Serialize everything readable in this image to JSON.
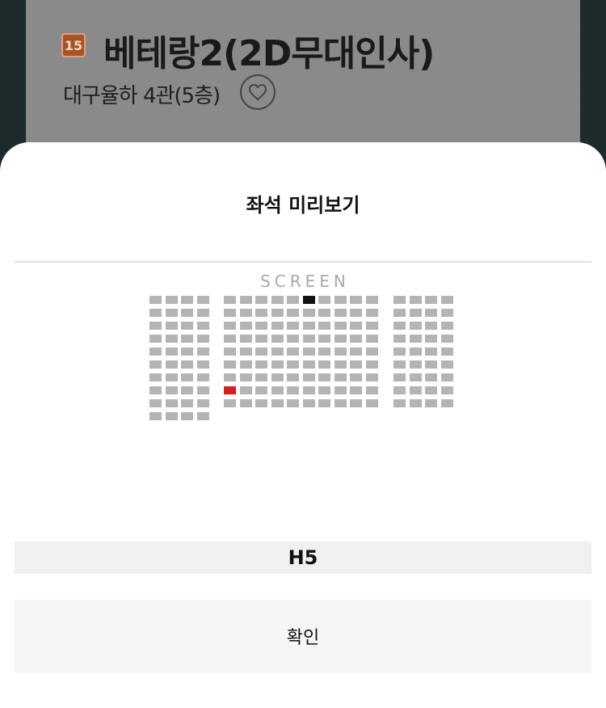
{
  "movie": {
    "age_rating": "15",
    "title": "베테랑2(2D무대인사)",
    "theater": "대구율하 4관(5층)"
  },
  "sheet": {
    "title": "좌석 미리보기",
    "screen_label": "SCREEN",
    "selected_seat": "H5",
    "confirm_label": "확인"
  },
  "seat_map": {
    "left_block": {
      "cols": 4,
      "rows": 10
    },
    "center_block": {
      "cols": 10,
      "rows": 9
    },
    "right_block": {
      "cols": 4,
      "rows": 9
    },
    "taken_seats": [
      {
        "block": "center",
        "row": 0,
        "col": 5
      }
    ],
    "selected_seats": [
      {
        "block": "center",
        "row": 7,
        "col": 0
      }
    ]
  },
  "colors": {
    "seat_available": "#b4b4b4",
    "seat_taken": "#111111",
    "seat_selected": "#d21e1e",
    "age_badge": "#a8542a"
  },
  "icons": {
    "favorite": "heart-outline-icon"
  }
}
